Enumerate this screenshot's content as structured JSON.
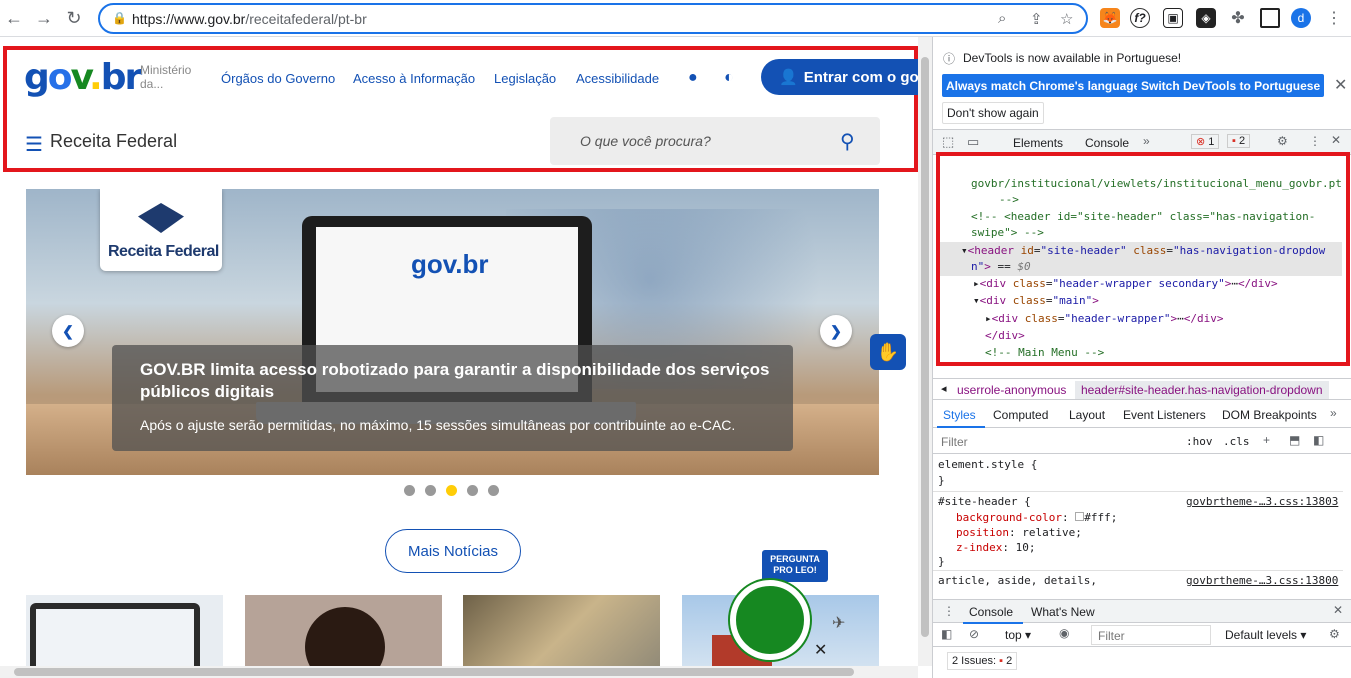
{
  "browser": {
    "url_host": "https://www.gov.br",
    "url_path": "/receitafederal/pt-br"
  },
  "site": {
    "ministerio": "Ministério da...",
    "nav": [
      "Órgãos do Governo",
      "Acesso à Informação",
      "Legislação",
      "Acessibilidade"
    ],
    "enter_button": "Entrar com o gov.br",
    "site_name": "Receita Federal",
    "search_placeholder": "O que você procura?"
  },
  "carousel": {
    "badge": "Receita Federal",
    "headline": "GOV.BR limita acesso robotizado para garantir a disponibilidade dos serviços públicos digitais",
    "subtext": "Após o ajuste serão permitidas, no máximo, 15 sessões simultâneas por contribuinte ao e-CAC.",
    "laptop_logo": "gov.br",
    "slides": 5,
    "active_slide": 3
  },
  "more_news": "Mais Notícias",
  "leo": {
    "tag_line1": "PERGUNTA",
    "tag_line2": "PRO LEO!"
  },
  "devtools": {
    "banner": "DevTools is now available in Portuguese!",
    "btn_match": "Always match Chrome's language",
    "btn_switch": "Switch DevTools to Portuguese",
    "btn_dont": "Don't show again",
    "tabs": [
      "Elements",
      "Console"
    ],
    "errors": "1",
    "warnings": "2",
    "dom_lines": [
      "govbr/institucional/viewlets/institucional_menu_govbr.pt",
      "-->",
      "<!-- <header id=\"site-header\" class=\"has-navigation-",
      "swipe\"> -->"
    ],
    "breadcrumb": [
      "userrole-anonymous",
      "header#site-header.has-navigation-dropdown"
    ],
    "style_tabs": [
      "Styles",
      "Computed",
      "Layout",
      "Event Listeners",
      "DOM Breakpoints"
    ],
    "filter": "Filter",
    "hov": ":hov",
    "cls": ".cls",
    "element_style": "element.style {",
    "source1": "govbrtheme-…3.css:13803",
    "source2": "govbrtheme-…3.css:13800",
    "drawer_tabs": [
      "Console",
      "What's New"
    ],
    "context": "top",
    "levels": "Default levels",
    "issues": "2 Issues:",
    "issues_count": "2"
  }
}
